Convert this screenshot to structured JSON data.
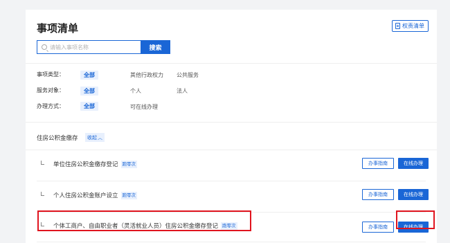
{
  "header": {
    "title": "事项清单",
    "rights_button": "权责清单"
  },
  "search": {
    "placeholder": "请输入事项名称",
    "value": "",
    "button": "搜索"
  },
  "filters": [
    {
      "label": "事项类型：",
      "selected": "全部",
      "options": [
        "其他行政权力",
        "公共服务"
      ]
    },
    {
      "label": "服务对象：",
      "selected": "全部",
      "options": [
        "个人",
        "法人"
      ]
    },
    {
      "label": "办理方式：",
      "selected": "全部",
      "options": [
        "可在线办理"
      ]
    }
  ],
  "section": {
    "title": "住房公积金缴存",
    "collapse_label": "收起",
    "collapse_icon": "chevron-up-icon"
  },
  "items": [
    {
      "name": "单位住房公积金缴存登记",
      "tag": "跑零次",
      "guide": "办事指南",
      "online": "在线办理"
    },
    {
      "name": "个人住房公积金账户设立",
      "tag": "跑零次",
      "guide": "办事指南",
      "online": "在线办理"
    },
    {
      "name": "个体工商户、自由职业者（灵活就业人员）住房公积金缴存登记",
      "tag": "跑零次",
      "guide": "办事指南",
      "online": "在线办理"
    }
  ],
  "colors": {
    "accent": "#1a66d6",
    "highlight": "#e0141e",
    "tag_bg": "#e8f0fd"
  }
}
